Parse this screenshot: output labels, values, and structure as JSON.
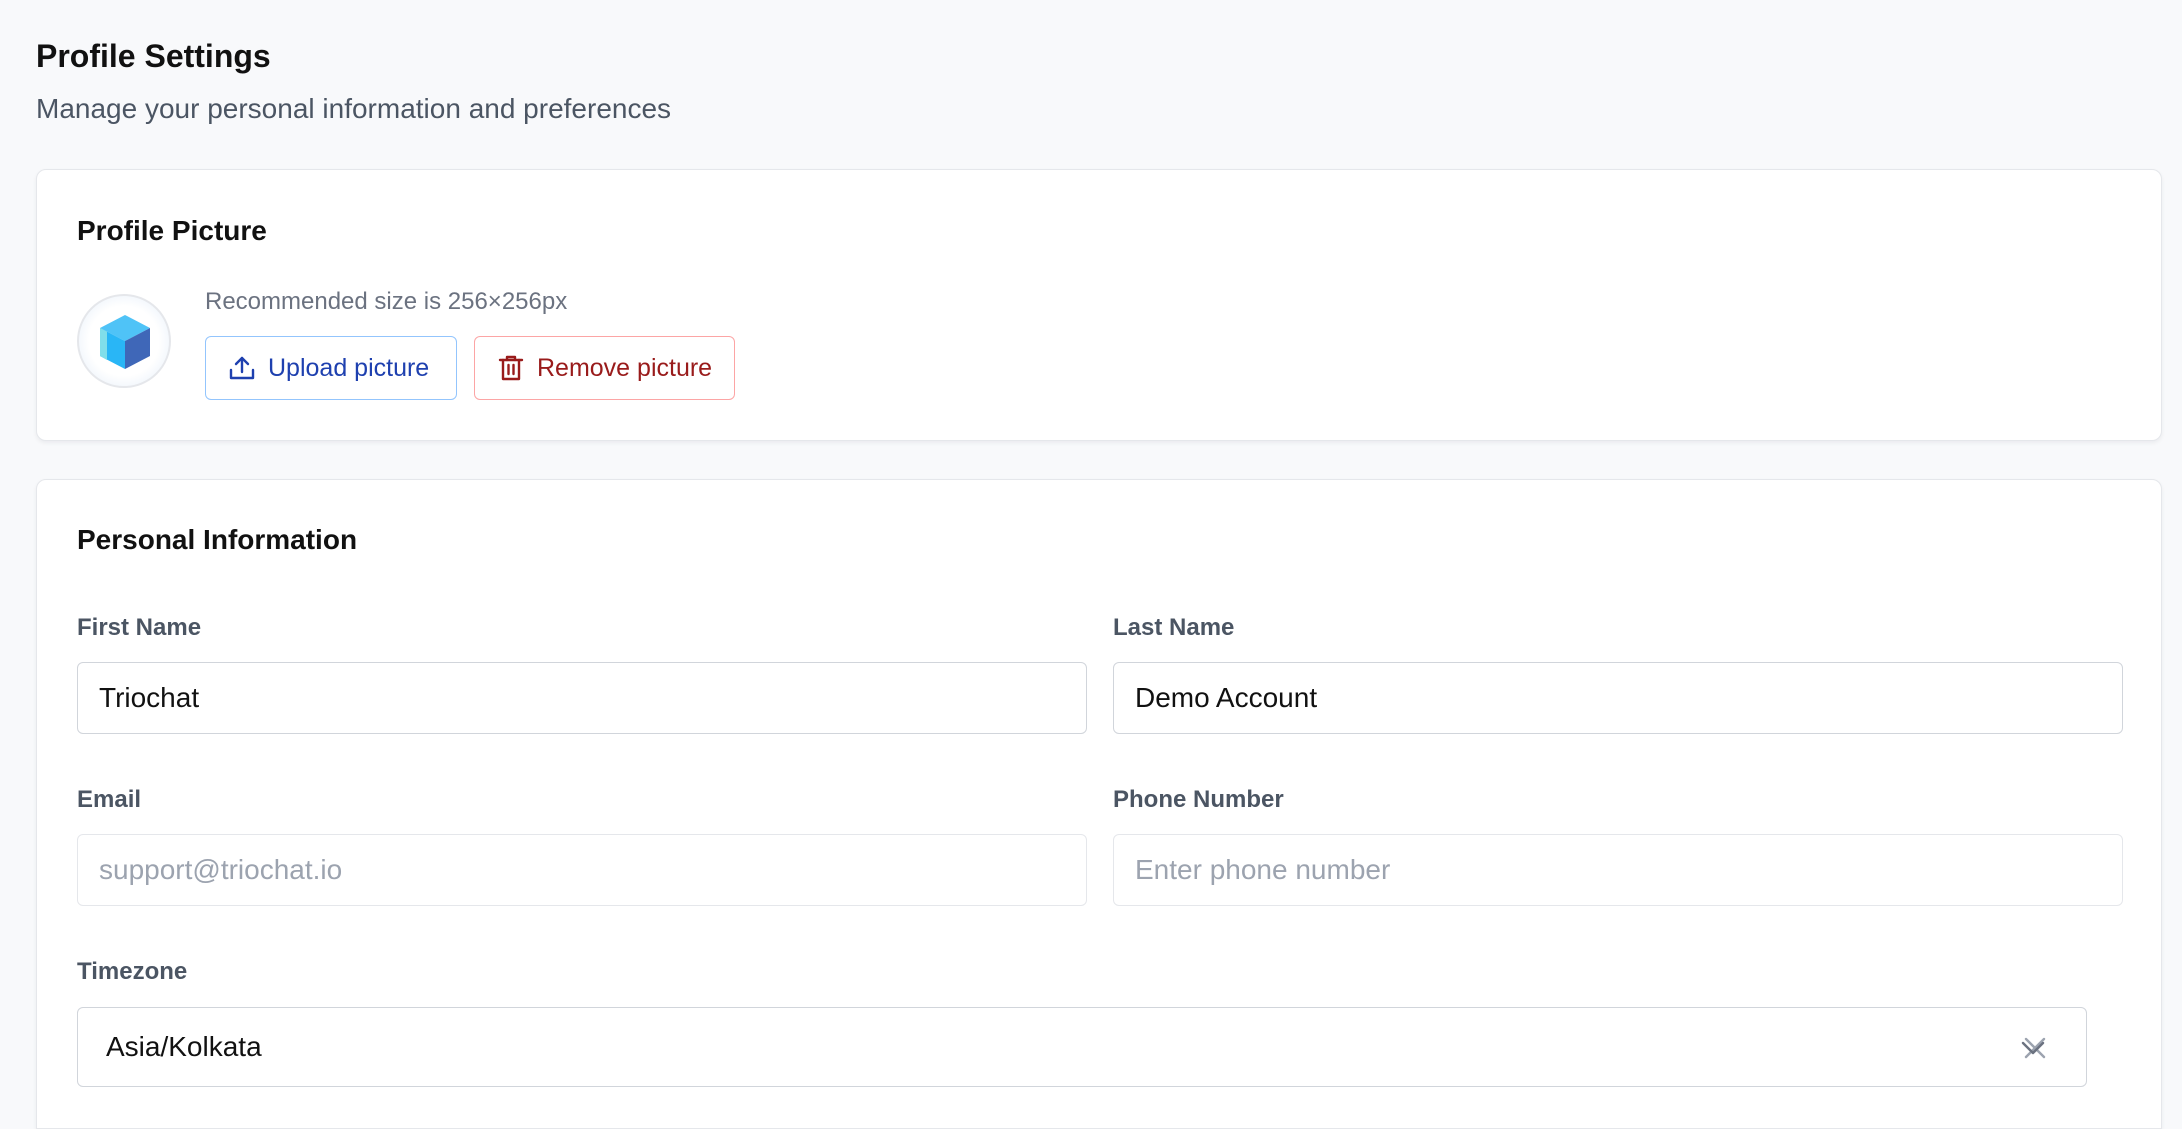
{
  "header": {
    "title": "Profile Settings",
    "subtitle": "Manage your personal information and preferences"
  },
  "profile_picture": {
    "title": "Profile Picture",
    "hint": "Recommended size is 256×256px",
    "avatar_icon": "cube-logo-icon",
    "upload_label": "Upload picture",
    "upload_icon": "upload-icon",
    "remove_label": "Remove picture",
    "remove_icon": "trash-icon"
  },
  "personal_info": {
    "title": "Personal Information",
    "first_name": {
      "label": "First Name",
      "value": "Triochat"
    },
    "last_name": {
      "label": "Last Name",
      "value": "Demo Account"
    },
    "email": {
      "label": "Email",
      "value": "support@triochat.io"
    },
    "phone": {
      "label": "Phone Number",
      "value": "",
      "placeholder": "Enter phone number"
    },
    "timezone": {
      "label": "Timezone",
      "value": "Asia/Kolkata"
    }
  },
  "colors": {
    "background": "#f8f9fb",
    "upload_accent": "#1e40af",
    "upload_border": "#93c5fd",
    "remove_accent": "#991b1b",
    "remove_border": "#fca5a5"
  }
}
